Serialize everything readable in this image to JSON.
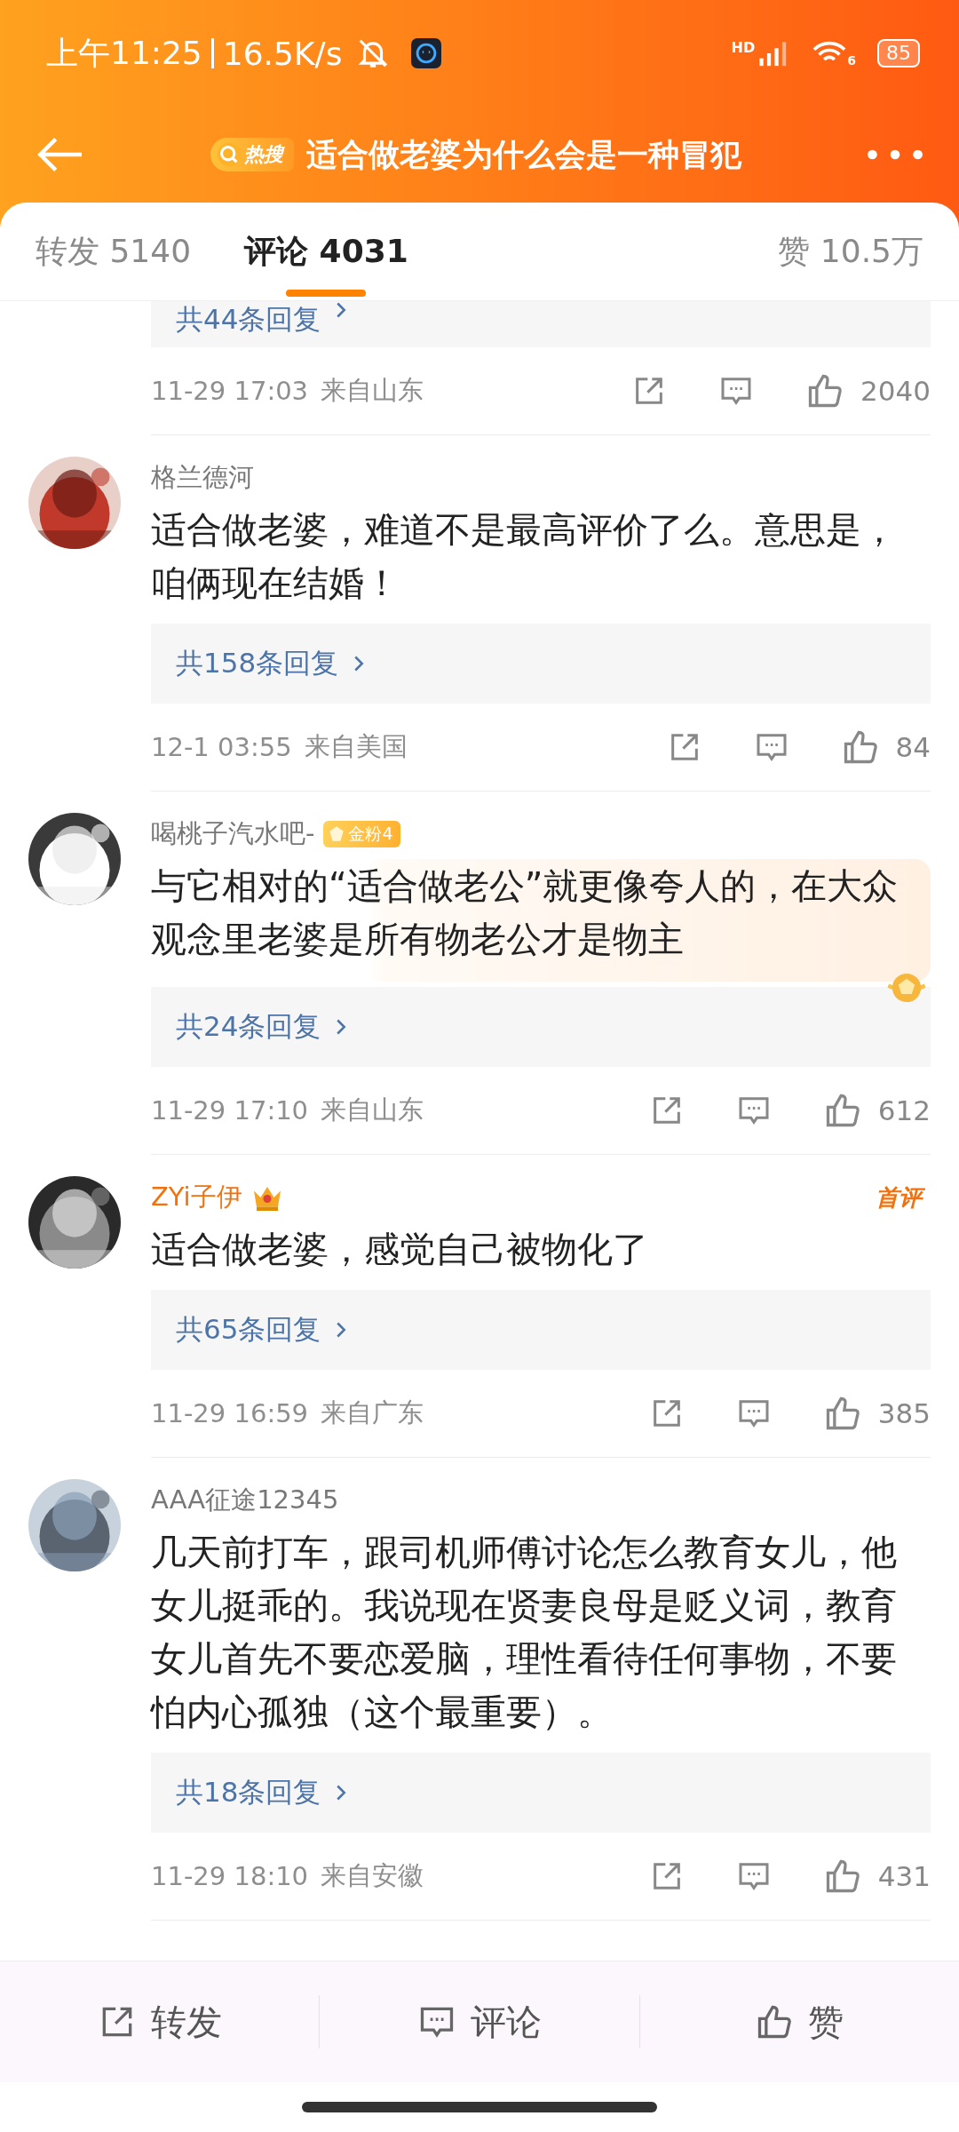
{
  "status_bar": {
    "time": "上午11:25",
    "speed": "16.5K/s",
    "network_label": "HD",
    "wifi_label": "6",
    "battery": "85"
  },
  "header": {
    "hot_tag": "热搜",
    "title": "适合做老婆为什么会是一种冒犯"
  },
  "tabs": [
    {
      "label": "转发 5140",
      "selected": false
    },
    {
      "label": "评论 4031",
      "selected": true
    },
    {
      "label": "赞 10.5万",
      "selected": false
    }
  ],
  "comments": [
    {
      "replies": "共44条回复",
      "time": "11-29 17:03",
      "location": "来自山东",
      "likes": "2040"
    },
    {
      "name": "格兰德河",
      "vip": false,
      "text": "适合做老婆，难道不是最高评价了么。意思是，咱俩现在结婚！",
      "decorated": false,
      "replies": "共158条回复",
      "time": "12-1 03:55",
      "location": "来自美国",
      "likes": "84"
    },
    {
      "name": "喝桃子汽水吧-",
      "vip": false,
      "fan_badge": "金粉4",
      "text": "与它相对的“适合做老公”就更像夸人的，在大众观念里老婆是所有物老公才是物主",
      "decorated": true,
      "replies": "共24条回复",
      "time": "11-29 17:10",
      "location": "来自山东",
      "likes": "612"
    },
    {
      "name": "ZYi子伊",
      "vip": true,
      "crown": true,
      "tag": "首评",
      "text": "适合做老婆，感觉自己被物化了",
      "decorated": false,
      "replies": "共65条回复",
      "time": "11-29 16:59",
      "location": "来自广东",
      "likes": "385"
    },
    {
      "name": "AAA征途12345",
      "vip": false,
      "text": "几天前打车，跟司机师傅讨论怎么教育女儿，他女儿挺乖的。我说现在贤妻良母是贬义词，教育女儿首先不要恋爱脑，理性看待任何事物，不要怕内心孤独（这个最重要）。",
      "decorated": false,
      "replies": "共18条回复",
      "time": "11-29 18:10",
      "location": "来自安徽",
      "likes": "431"
    }
  ],
  "bottom_bar": [
    {
      "kind": "repost",
      "label": "转发"
    },
    {
      "kind": "comment",
      "label": "评论"
    },
    {
      "kind": "like",
      "label": "赞"
    }
  ]
}
